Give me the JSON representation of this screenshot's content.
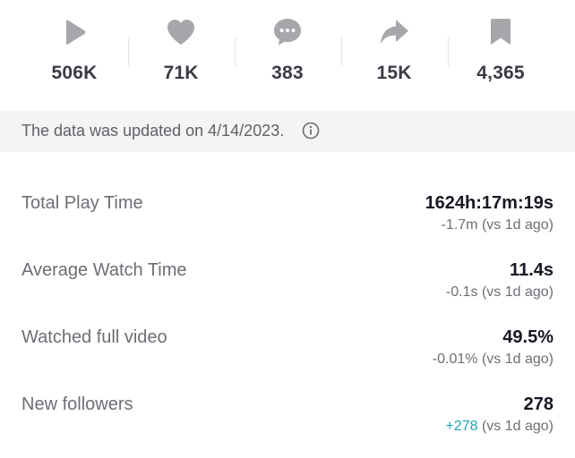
{
  "stats": [
    {
      "icon": "play-icon",
      "value": "506K"
    },
    {
      "icon": "heart-icon",
      "value": "71K"
    },
    {
      "icon": "comment-icon",
      "value": "383"
    },
    {
      "icon": "share-icon",
      "value": "15K"
    },
    {
      "icon": "bookmark-icon",
      "value": "4,365"
    }
  ],
  "notice": {
    "text": "The data was updated on 4/14/2023."
  },
  "metrics": [
    {
      "label": "Total Play Time",
      "value": "1624h:17m:19s",
      "delta": "-1.7m",
      "compare": "(vs 1d ago)"
    },
    {
      "label": "Average Watch Time",
      "value": "11.4s",
      "delta": "-0.1s",
      "compare": "(vs 1d ago)"
    },
    {
      "label": "Watched full video",
      "value": "49.5%",
      "delta": "-0.01%",
      "compare": "(vs 1d ago)"
    },
    {
      "label": "New followers",
      "value": "278",
      "delta": "+278",
      "compare": "(vs 1d ago)"
    }
  ],
  "colors": {
    "icon_gray": "#a6a7ab",
    "positive_delta": "#20a0b8",
    "notice_bg": "#f4f4f4"
  }
}
